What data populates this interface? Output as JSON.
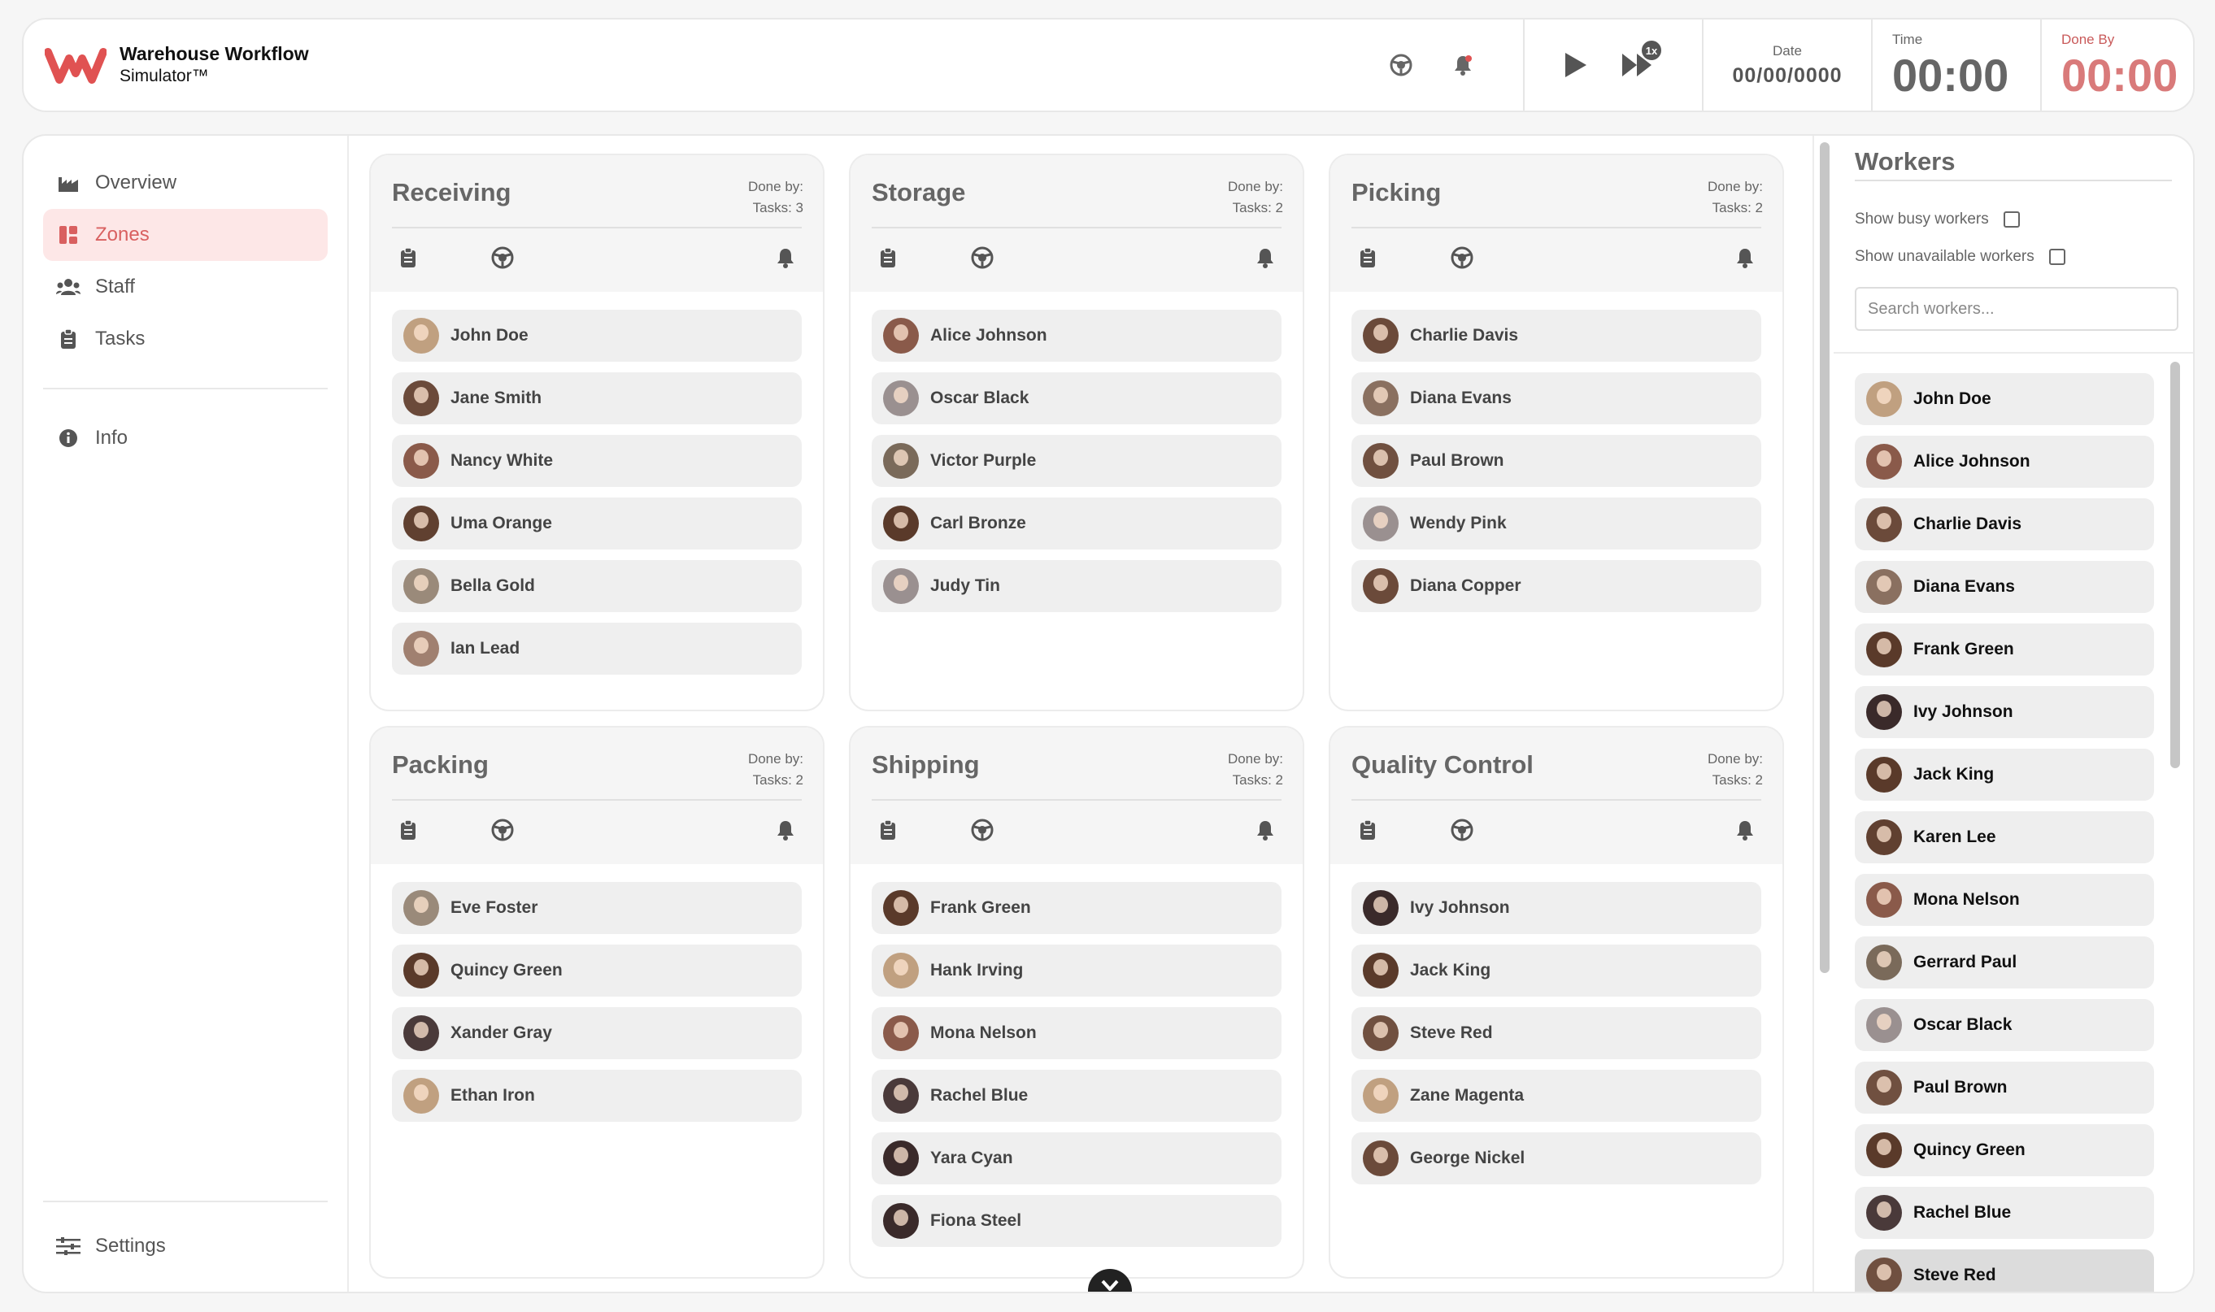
{
  "app": {
    "title_line1": "Warehouse Workflow",
    "title_line2": "Simulator™",
    "brand_color": "#e05252"
  },
  "topbar": {
    "icons": [
      "globe-icon",
      "bell-icon"
    ],
    "play_icon": "play-icon",
    "fast_forward_icon": "fast-forward-icon",
    "speed": "1x",
    "date_label": "Date",
    "date_value": "00/00/0000",
    "time_label": "Time",
    "time_value": "00:00",
    "done_label": "Done By",
    "done_value": "00:00"
  },
  "sidebar": {
    "items": [
      {
        "label": "Overview",
        "icon": "factory-icon",
        "active": false
      },
      {
        "label": "Zones",
        "icon": "zones-icon",
        "active": true
      },
      {
        "label": "Staff",
        "icon": "people-icon",
        "active": false
      },
      {
        "label": "Tasks",
        "icon": "clipboard-icon",
        "active": false
      },
      {
        "label": "Info",
        "icon": "info-icon",
        "active": false
      }
    ],
    "settings_label": "Settings"
  },
  "zones": [
    {
      "title": "Receiving",
      "done_by": "Done by:",
      "tasks": "Tasks: 3",
      "workers": [
        "John Doe",
        "Jane Smith",
        "Nancy White",
        "Uma Orange",
        "Bella Gold",
        "Ian Lead"
      ]
    },
    {
      "title": "Storage",
      "done_by": "Done by:",
      "tasks": "Tasks: 2",
      "workers": [
        "Alice Johnson",
        "Oscar Black",
        "Victor Purple",
        "Carl Bronze",
        "Judy Tin"
      ]
    },
    {
      "title": "Picking",
      "done_by": "Done by:",
      "tasks": "Tasks: 2",
      "workers": [
        "Charlie Davis",
        "Diana Evans",
        "Paul Brown",
        "Wendy Pink",
        "Diana Copper"
      ]
    },
    {
      "title": "Packing",
      "done_by": "Done by:",
      "tasks": "Tasks: 2",
      "workers": [
        "Eve Foster",
        "Quincy Green",
        "Xander Gray",
        "Ethan Iron"
      ]
    },
    {
      "title": "Shipping",
      "done_by": "Done by:",
      "tasks": "Tasks: 2",
      "workers": [
        "Frank Green",
        "Hank Irving",
        "Mona Nelson",
        "Rachel Blue",
        "Yara Cyan",
        "Fiona Steel"
      ]
    },
    {
      "title": "Quality Control",
      "done_by": "Done by:",
      "tasks": "Tasks: 2",
      "workers": [
        "Ivy Johnson",
        "Jack King",
        "Steve Red",
        "Zane Magenta",
        "George Nickel"
      ]
    }
  ],
  "workers_panel": {
    "title": "Workers",
    "show_busy_label": "Show busy workers",
    "show_busy_checked": false,
    "show_unavailable_label": "Show unavailable workers",
    "show_unavailable_checked": false,
    "search_placeholder": "Search workers...",
    "workers": [
      "John Doe",
      "Alice Johnson",
      "Charlie Davis",
      "Diana Evans",
      "Frank Green",
      "Ivy Johnson",
      "Jack King",
      "Karen Lee",
      "Mona Nelson",
      "Gerrard Paul",
      "Oscar Black",
      "Paul Brown",
      "Quincy Green",
      "Rachel Blue",
      "Steve Red"
    ]
  },
  "zone_icons": [
    "clipboard-icon",
    "globe-icon",
    "bell-icon"
  ],
  "scroll_down_icon": "chevron-down-icon"
}
